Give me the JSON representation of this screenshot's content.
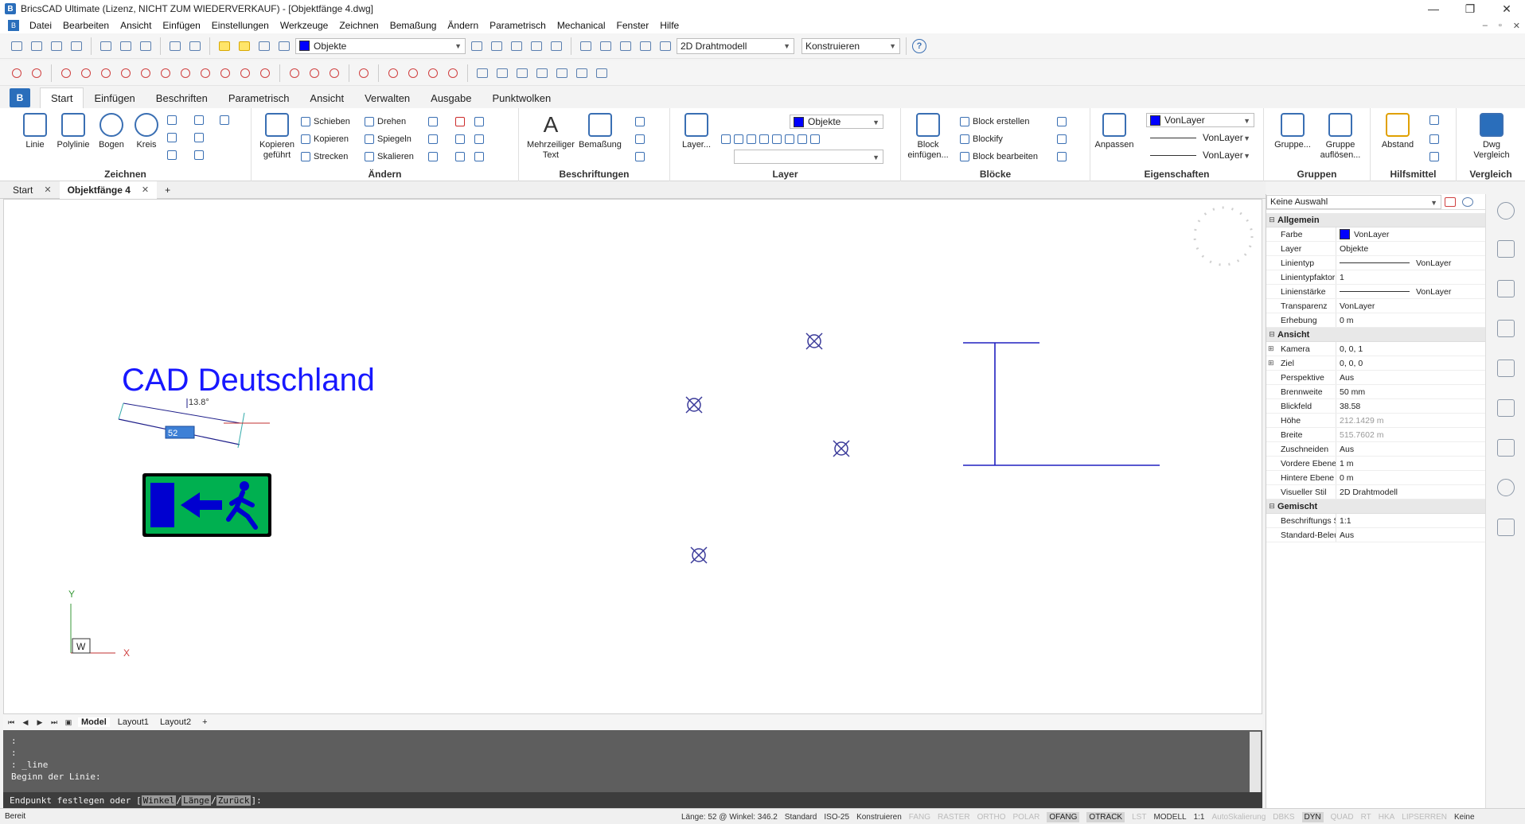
{
  "window": {
    "title": "BricsCAD Ultimate (Lizenz, NICHT ZUM WIEDERVERKAUF) - [Objektfänge 4.dwg]",
    "controls": [
      "—",
      "❐",
      "✕"
    ]
  },
  "menu": [
    "Datei",
    "Bearbeiten",
    "Ansicht",
    "Einfügen",
    "Einstellungen",
    "Werkzeuge",
    "Zeichnen",
    "Bemaßung",
    "Ändern",
    "Parametrisch",
    "Mechanical",
    "Fenster",
    "Hilfe"
  ],
  "toolbar": {
    "layer_combo": "Objekte",
    "visual_style": "2D Drahtmodell",
    "workspace": "Konstruieren",
    "help_icon": "?"
  },
  "ribbon": {
    "tabs": [
      "Start",
      "Einfügen",
      "Beschriften",
      "Parametrisch",
      "Ansicht",
      "Verwalten",
      "Ausgabe",
      "Punktwolken"
    ],
    "active_tab": "Start",
    "groups": {
      "zeichnen": {
        "title": "Zeichnen",
        "buttons": [
          "Linie",
          "Polylinie",
          "Bogen",
          "Kreis"
        ]
      },
      "aendern": {
        "title": "Ändern",
        "big": "Kopieren geführt",
        "items": [
          "Schieben",
          "Drehen",
          "Kopieren",
          "Spiegeln",
          "Strecken",
          "Skalieren"
        ]
      },
      "beschriftungen": {
        "title": "Beschriftungen",
        "buttons": [
          "Mehrzeiliger Text",
          "Bemaßung"
        ]
      },
      "layer": {
        "title": "Layer",
        "button": "Layer...",
        "combo": "Objekte"
      },
      "bloecke": {
        "title": "Blöcke",
        "big": "Block einfügen...",
        "items": [
          "Block erstellen",
          "Blockify",
          "Block bearbeiten"
        ]
      },
      "eigenschaften": {
        "title": "Eigenschaften",
        "button": "Anpassen",
        "color": "VonLayer",
        "linetype": "VonLayer",
        "lineweight": "VonLayer"
      },
      "gruppen": {
        "title": "Gruppen",
        "buttons": [
          "Gruppe...",
          "Gruppe auflösen..."
        ]
      },
      "hilfsmittel": {
        "title": "Hilfsmittel",
        "button": "Abstand"
      },
      "vergleich": {
        "title": "Vergleich",
        "button": "Dwg Vergleich"
      }
    }
  },
  "doc_tabs": [
    {
      "label": "Start",
      "active": false
    },
    {
      "label": "Objektfänge 4",
      "active": true
    }
  ],
  "canvas": {
    "text": "CAD Deutschland",
    "angle_label": "13.8°",
    "length_input": "52",
    "ucs_y": "Y",
    "ucs_x": "X",
    "ucs_w": "W"
  },
  "layout_tabs": [
    "Model",
    "Layout1",
    "Layout2",
    "+"
  ],
  "command": {
    "history": [
      ":",
      ":",
      ": _line",
      "Beginn der Linie:"
    ],
    "prompt_prefix": "Endpunkt festlegen oder [",
    "options": [
      "Winkel",
      "Länge",
      "Zurück"
    ],
    "prompt_suffix": "]:"
  },
  "status": {
    "left": "Bereit",
    "items": [
      {
        "label": "Länge: 52 @ Winkel: 346.2",
        "state": "norm"
      },
      {
        "label": "Standard",
        "state": "norm"
      },
      {
        "label": "ISO-25",
        "state": "norm"
      },
      {
        "label": "Konstruieren",
        "state": "norm"
      },
      {
        "label": "FANG",
        "state": "off"
      },
      {
        "label": "RASTER",
        "state": "off"
      },
      {
        "label": "ORTHO",
        "state": "off"
      },
      {
        "label": "POLAR",
        "state": "off"
      },
      {
        "label": "OFANG",
        "state": "on"
      },
      {
        "label": "OTRACK",
        "state": "on"
      },
      {
        "label": "LST",
        "state": "off"
      },
      {
        "label": "MODELL",
        "state": "norm"
      },
      {
        "label": "1:1",
        "state": "norm"
      },
      {
        "label": "AutoSkalierung",
        "state": "off"
      },
      {
        "label": "DBKS",
        "state": "off"
      },
      {
        "label": "DYN",
        "state": "on"
      },
      {
        "label": "QUAD",
        "state": "off"
      },
      {
        "label": "RT",
        "state": "off"
      },
      {
        "label": "HKA",
        "state": "off"
      },
      {
        "label": "LIPSERREN",
        "state": "off"
      },
      {
        "label": "Keine",
        "state": "norm"
      }
    ]
  },
  "properties": {
    "selection": "Keine Auswahl",
    "sections": [
      {
        "title": "Allgemein",
        "rows": [
          {
            "key": "Farbe",
            "value": "VonLayer",
            "swatch": true
          },
          {
            "key": "Layer",
            "value": "Objekte"
          },
          {
            "key": "Linientyp",
            "value": "VonLayer",
            "line": true
          },
          {
            "key": "Linientypfaktor",
            "value": "1"
          },
          {
            "key": "Linienstärke",
            "value": "VonLayer",
            "line": true
          },
          {
            "key": "Transparenz",
            "value": "VonLayer"
          },
          {
            "key": "Erhebung",
            "value": "0 m"
          }
        ]
      },
      {
        "title": "Ansicht",
        "rows": [
          {
            "key": "Kamera",
            "value": "0, 0, 1",
            "expand": true
          },
          {
            "key": "Ziel",
            "value": "0, 0, 0",
            "expand": true
          },
          {
            "key": "Perspektive",
            "value": "Aus"
          },
          {
            "key": "Brennweite",
            "value": "50 mm"
          },
          {
            "key": "Blickfeld",
            "value": "38.58"
          },
          {
            "key": "Höhe",
            "value": "212.1429 m",
            "gray": true
          },
          {
            "key": "Breite",
            "value": "515.7602 m",
            "gray": true
          },
          {
            "key": "Zuschneiden",
            "value": "Aus"
          },
          {
            "key": "Vordere Ebene",
            "value": "1 m"
          },
          {
            "key": "Hintere Ebene",
            "value": "0 m"
          },
          {
            "key": "Visueller Stil",
            "value": "2D Drahtmodell"
          }
        ]
      },
      {
        "title": "Gemischt",
        "rows": [
          {
            "key": "Beschriftungs Skalierung",
            "value": "1:1"
          },
          {
            "key": "Standard-Beleuchtung",
            "value": "Aus"
          }
        ]
      }
    ]
  },
  "colors": {
    "accent": "#2a6ebb",
    "drawing_blue": "#0000ff",
    "node_marker": "#3b3b9a",
    "exit_sign_green": "#00b050"
  }
}
